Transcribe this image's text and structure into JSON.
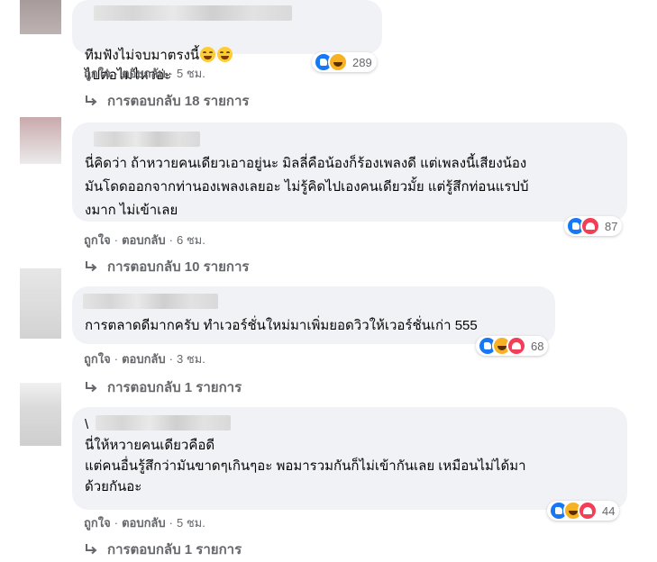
{
  "comments": [
    {
      "text_parts": [
        "ทีมฟังไม่จบมาตรงนี้",
        "ไปต่อไม่ไหวอ่ะ"
      ],
      "reaction_icons": [
        "like-icon",
        "haha-icon"
      ],
      "reaction_count": "289",
      "like_label": "ถูกใจ",
      "reply_label": "ตอบกลับ",
      "time": "5 ชม.",
      "replies_label": "การตอบกลับ 18 รายการ"
    },
    {
      "text": "นี่คิดว่า ถ้าหวายคนเดียวเอาอยู่นะ มิลลี่คือน้องก็ร้องเพลงดี แต่เพลงนี้เสียงน้อง\nมันโดดออกจากท่านองเพลงเลยอะ ไม่รู้คิดไปเองคนเดียวมั้ย แต่รู้สึกท่อนแรปบ้\nงมาก ไม่เข้าเลย",
      "reaction_icons": [
        "like-icon",
        "love-icon"
      ],
      "reaction_count": "87",
      "like_label": "ถูกใจ",
      "reply_label": "ตอบกลับ",
      "time": "6 ชม.",
      "replies_label": "การตอบกลับ 10 รายการ"
    },
    {
      "text": "การตลาดดีมากครับ ทำเวอร์ชั่นใหม่มาเพิ่มยอดวิวให้เวอร์ชั่นเก่า 555",
      "reaction_icons": [
        "like-icon",
        "haha-icon",
        "love-icon"
      ],
      "reaction_count": "68",
      "like_label": "ถูกใจ",
      "reply_label": "ตอบกลับ",
      "time": "3 ชม.",
      "replies_label": "การตอบกลับ 1 รายการ"
    },
    {
      "text": "\\\nนี่ให้หวายคนเดียวคือดี\nแต่คนอื่นรู้สึกว่ามันขาดๆเกินๆอะ พอมารวมกันก็ไม่เข้ากันเลย เหมือนไม่ได้มา\nด้วยกันอะ",
      "reaction_icons": [
        "like-icon",
        "haha-icon",
        "love-icon"
      ],
      "reaction_count": "44",
      "like_label": "ถูกใจ",
      "reply_label": "ตอบกลับ",
      "time": "5 ชม.",
      "replies_label": "การตอบกลับ 1 รายการ"
    }
  ],
  "colors": {
    "bubble": "#f0f2f5",
    "secondary_text": "#65676b",
    "like": "#1877f2",
    "haha": "#f7b125",
    "love": "#f33e58"
  }
}
